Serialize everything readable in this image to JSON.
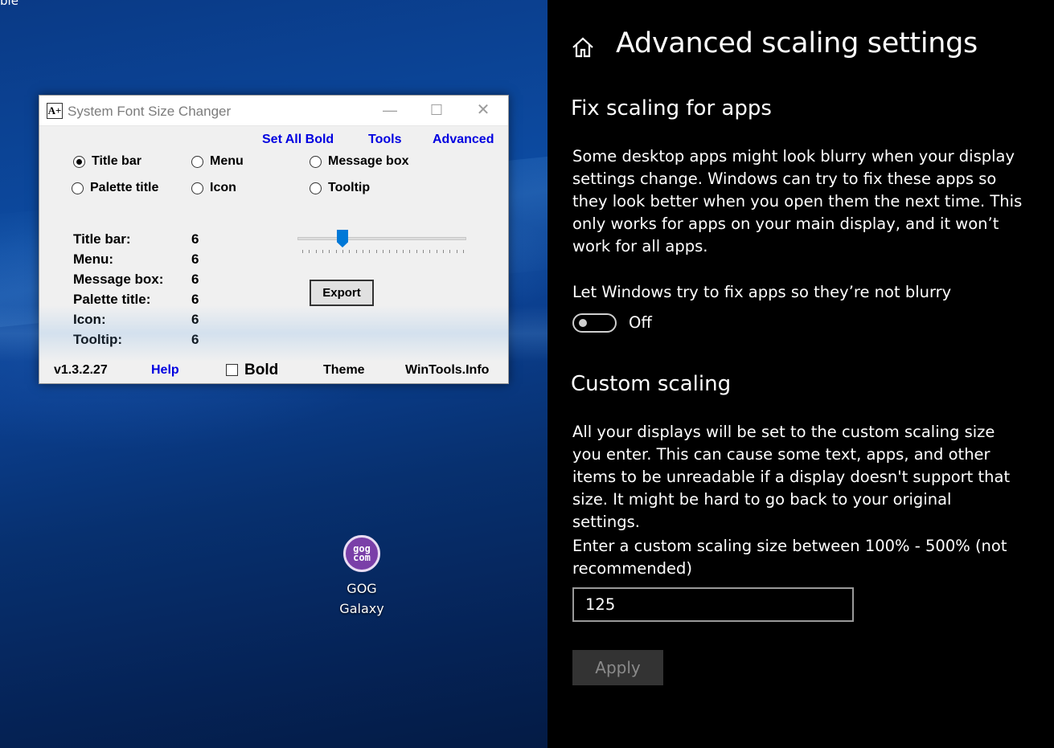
{
  "desktop": {
    "corner_label": "ble",
    "gog": {
      "logo_top": "gog",
      "logo_bottom": "com",
      "label_line1": "GOG",
      "label_line2": "Galaxy"
    }
  },
  "fsc": {
    "title": "System Font Size Changer",
    "app_icon": "A+",
    "controls": {
      "minimize": "—",
      "maximize": "☐",
      "close": "✕"
    },
    "links": {
      "set_all_bold": "Set All Bold",
      "tools": "Tools",
      "advanced": "Advanced"
    },
    "radios": [
      {
        "label": "Title bar",
        "checked": true
      },
      {
        "label": "Menu",
        "checked": false
      },
      {
        "label": "Message box",
        "checked": false
      },
      {
        "label": "Palette title",
        "checked": false
      },
      {
        "label": "Icon",
        "checked": false
      },
      {
        "label": "Tooltip",
        "checked": false
      }
    ],
    "stats": [
      {
        "label": "Title bar:",
        "value": "6"
      },
      {
        "label": "Menu:",
        "value": "6"
      },
      {
        "label": "Message box:",
        "value": "6"
      },
      {
        "label": "Palette title:",
        "value": "6"
      },
      {
        "label": "Icon:",
        "value": "6"
      },
      {
        "label": "Tooltip:",
        "value": "6"
      }
    ],
    "slider": {
      "min": 0,
      "max": 24,
      "value": 6
    },
    "export_label": "Export",
    "footer": {
      "version": "v1.3.2.27",
      "help": "Help",
      "bold": "Bold",
      "bold_checked": false,
      "theme": "Theme",
      "site": "WinTools.Info"
    }
  },
  "settings": {
    "title": "Advanced scaling settings",
    "fix_section": {
      "heading": "Fix scaling for apps",
      "description": "Some desktop apps might look blurry when your display settings change. Windows can try to fix these apps so they look better when you open them the next time. This only works for apps on your main display, and it won’t work for all apps.",
      "toggle_label": "Let Windows try to fix apps so they’re not blurry",
      "toggle_state": "Off"
    },
    "custom_section": {
      "heading": "Custom scaling",
      "description": "All your displays will be set to the custom scaling size you enter. This can cause some text, apps, and other items to be unreadable if a display doesn't support that size. It might be hard to go back to your original settings.",
      "input_label": "Enter a custom scaling size between 100% - 500% (not recommended)",
      "input_value": "125",
      "apply_label": "Apply"
    }
  },
  "colors": {
    "link": "#0000e0",
    "accent": "#0078d7",
    "settings_bg": "#000000"
  }
}
